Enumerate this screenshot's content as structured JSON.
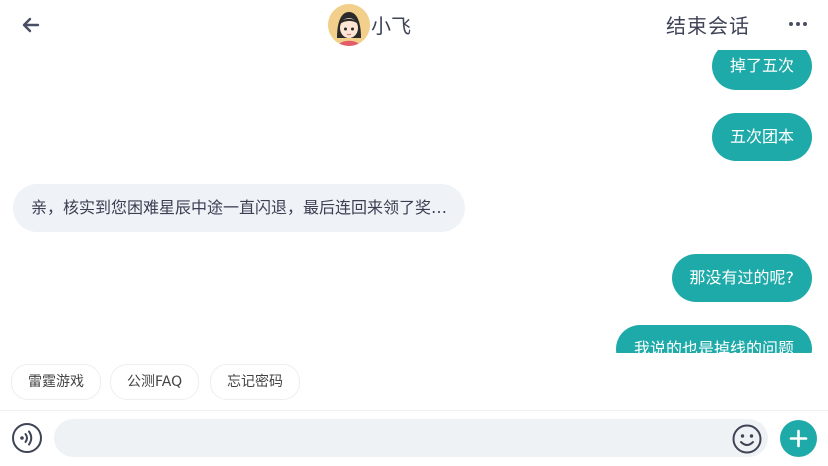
{
  "header": {
    "agent_name": "小飞",
    "end_session_label": "结束会话",
    "icons": {
      "back": "back-arrow-icon",
      "more": "more-dots-icon"
    }
  },
  "messages": [
    {
      "side": "out",
      "text": "掉了五次"
    },
    {
      "side": "out",
      "text": "五次团本"
    },
    {
      "side": "in",
      "text": "亲，核实到您困难星辰中途一直闪退，最后连回来领了奖…"
    },
    {
      "side": "out",
      "text": "那没有过的呢?"
    },
    {
      "side": "out",
      "text": "我说的也是掉线的问题"
    }
  ],
  "quick_replies": [
    "雷霆游戏",
    "公测FAQ",
    "忘记密码"
  ],
  "input_bar": {
    "placeholder": "",
    "icons": {
      "voice": "voice-icon",
      "emoji": "emoji-icon",
      "add": "plus-icon"
    }
  },
  "colors": {
    "accent": "#1eaaa8",
    "incoming_bubble": "#eff2f6",
    "avatar_bg": "#f2cf8a"
  }
}
